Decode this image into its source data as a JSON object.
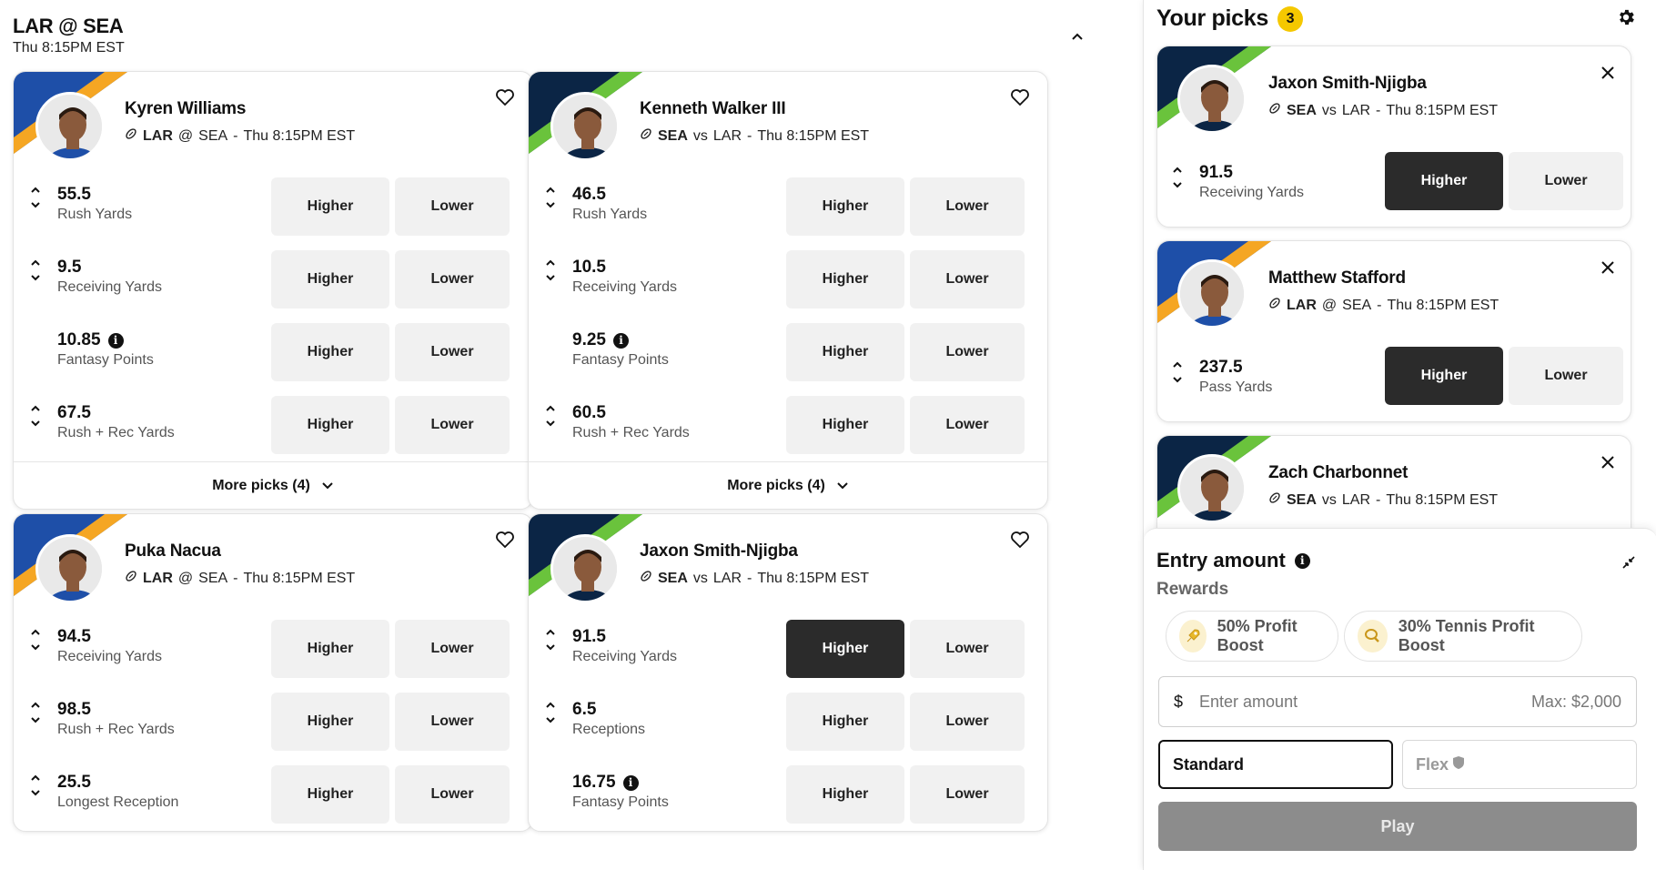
{
  "game": {
    "title": "LAR @ SEA",
    "time": "Thu 8:15PM EST"
  },
  "colors": {
    "rams_blue": "#1e4fa8",
    "rams_gold": "#f5a623",
    "sea_navy": "#0b2545",
    "sea_green": "#6ac33c",
    "active_button": "#2b2b2b",
    "badge": "#f5c800"
  },
  "buttons": {
    "higher": "Higher",
    "lower": "Lower"
  },
  "cards": [
    {
      "team": "rams",
      "name": "Kyren Williams",
      "team_abbr": "LAR",
      "sep": "@",
      "opp": "SEA",
      "when": "Thu 8:15PM EST",
      "stats": [
        {
          "value": "55.5",
          "label": "Rush Yards",
          "arrows": true,
          "info": false,
          "selected": ""
        },
        {
          "value": "9.5",
          "label": "Receiving Yards",
          "arrows": true,
          "info": false,
          "selected": ""
        },
        {
          "value": "10.85",
          "label": "Fantasy Points",
          "arrows": false,
          "info": true,
          "selected": ""
        },
        {
          "value": "67.5",
          "label": "Rush + Rec Yards",
          "arrows": true,
          "info": false,
          "selected": ""
        }
      ],
      "more": "More picks (4)"
    },
    {
      "team": "sea",
      "name": "Kenneth Walker III",
      "team_abbr": "SEA",
      "sep": "vs",
      "opp": "LAR",
      "when": "Thu 8:15PM EST",
      "stats": [
        {
          "value": "46.5",
          "label": "Rush Yards",
          "arrows": true,
          "info": false,
          "selected": ""
        },
        {
          "value": "10.5",
          "label": "Receiving Yards",
          "arrows": true,
          "info": false,
          "selected": ""
        },
        {
          "value": "9.25",
          "label": "Fantasy Points",
          "arrows": false,
          "info": true,
          "selected": ""
        },
        {
          "value": "60.5",
          "label": "Rush + Rec Yards",
          "arrows": true,
          "info": false,
          "selected": ""
        }
      ],
      "more": "More picks (4)"
    },
    {
      "team": "rams",
      "name": "Puka Nacua",
      "team_abbr": "LAR",
      "sep": "@",
      "opp": "SEA",
      "when": "Thu 8:15PM EST",
      "stats": [
        {
          "value": "94.5",
          "label": "Receiving Yards",
          "arrows": true,
          "info": false,
          "selected": ""
        },
        {
          "value": "98.5",
          "label": "Rush + Rec Yards",
          "arrows": true,
          "info": false,
          "selected": ""
        },
        {
          "value": "25.5",
          "label": "Longest Reception",
          "arrows": true,
          "info": false,
          "selected": ""
        }
      ]
    },
    {
      "team": "sea",
      "name": "Jaxon Smith-Njigba",
      "team_abbr": "SEA",
      "sep": "vs",
      "opp": "LAR",
      "when": "Thu 8:15PM EST",
      "stats": [
        {
          "value": "91.5",
          "label": "Receiving Yards",
          "arrows": true,
          "info": false,
          "selected": "higher"
        },
        {
          "value": "6.5",
          "label": "Receptions",
          "arrows": true,
          "info": false,
          "selected": ""
        },
        {
          "value": "16.75",
          "label": "Fantasy Points",
          "arrows": false,
          "info": true,
          "selected": ""
        }
      ]
    }
  ],
  "panel": {
    "title": "Your picks",
    "count": "3",
    "picks": [
      {
        "team": "sea",
        "name": "Jaxon Smith-Njigba",
        "team_abbr": "SEA",
        "sep": "vs",
        "opp": "LAR",
        "when": "Thu 8:15PM EST",
        "value": "91.5",
        "label": "Receiving Yards",
        "selected": "higher"
      },
      {
        "team": "rams",
        "name": "Matthew Stafford",
        "team_abbr": "LAR",
        "sep": "@",
        "opp": "SEA",
        "when": "Thu 8:15PM EST",
        "value": "237.5",
        "label": "Pass Yards",
        "selected": "higher"
      },
      {
        "team": "sea",
        "name": "Zach Charbonnet",
        "team_abbr": "SEA",
        "sep": "vs",
        "opp": "LAR",
        "when": "Thu 8:15PM EST",
        "value": "",
        "label": "",
        "selected": ""
      }
    ],
    "entry": {
      "title": "Entry amount",
      "rewards_label": "Rewards",
      "rewards": [
        {
          "label": "50% Profit Boost",
          "icon": "rocket-icon"
        },
        {
          "label": "30% Tennis Profit Boost",
          "icon": "tennis-icon"
        }
      ],
      "currency": "$",
      "placeholder": "Enter amount",
      "max": "Max: $2,000",
      "modes": {
        "standard": "Standard",
        "flex": "Flex"
      },
      "play": "Play"
    }
  }
}
